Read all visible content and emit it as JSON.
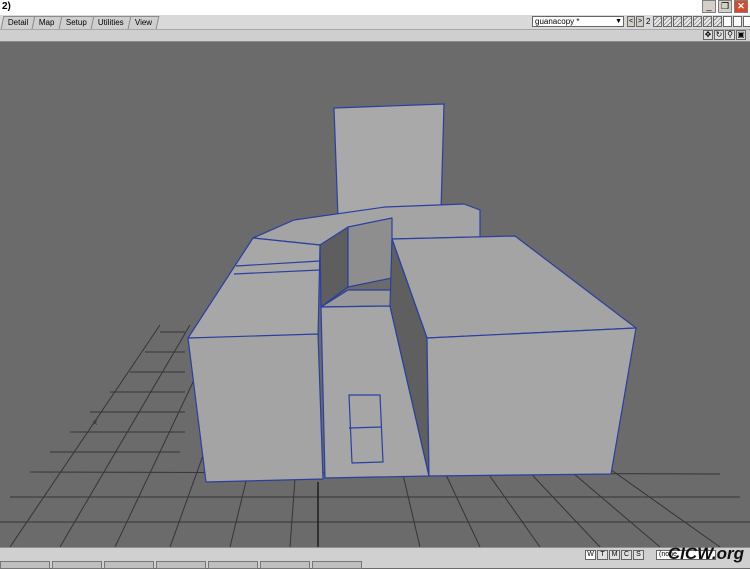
{
  "window": {
    "title": "2)",
    "minimize": "_",
    "restore": "❐",
    "close": "✕"
  },
  "tabs": [
    {
      "label": "Detail"
    },
    {
      "label": "Map"
    },
    {
      "label": "Setup"
    },
    {
      "label": "Utilities"
    },
    {
      "label": "View"
    }
  ],
  "object_select": {
    "value": "guanacopy *",
    "dropdown": "▼"
  },
  "nav": {
    "prev": "<",
    "next": ">"
  },
  "layer_number": "2",
  "layer_slots": 10,
  "viewport_icons": [
    {
      "name": "move-view-icon",
      "glyph": "✥"
    },
    {
      "name": "rotate-view-icon",
      "glyph": "↻"
    },
    {
      "name": "zoom-view-icon",
      "glyph": "⚲"
    },
    {
      "name": "maximize-view-icon",
      "glyph": "▣"
    }
  ],
  "view_buttons": [
    "W",
    "T",
    "M",
    "C",
    "S"
  ],
  "none_field": "(none",
  "watermark": "CICW.org",
  "colors": {
    "background": "#6b6b6b",
    "mesh_fill": "#a7a7a7",
    "edge": "#2a3f9f"
  }
}
